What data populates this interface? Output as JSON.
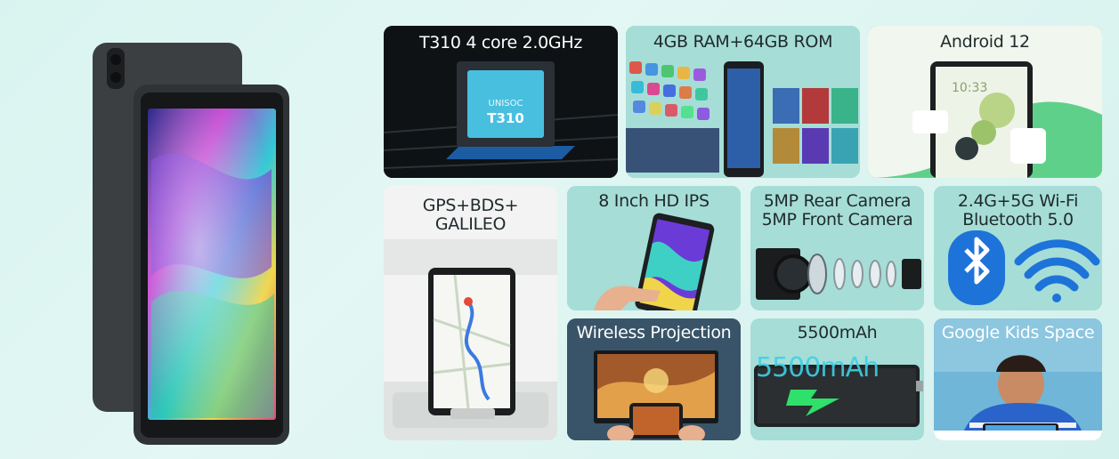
{
  "tiles": {
    "processor": {
      "label": "T310 4 core 2.0GHz",
      "chip_brand": "UNISOC",
      "chip_model": "T310"
    },
    "memory": {
      "label": "4GB RAM+64GB ROM"
    },
    "os": {
      "label": "Android 12",
      "clock": "10:33"
    },
    "gps": {
      "label_line1": "GPS+BDS+",
      "label_line2": "GALILEO"
    },
    "display": {
      "label": "8 Inch HD IPS"
    },
    "camera": {
      "label_line1": "5MP Rear Camera",
      "label_line2": "5MP Front Camera"
    },
    "wireless": {
      "label_line1": "2.4G+5G Wi-Fi",
      "label_line2": "Bluetooth 5.0"
    },
    "projection": {
      "label": "Wireless Projection"
    },
    "battery": {
      "label": "5500mAh",
      "overlay_text": "5500mAh"
    },
    "kids": {
      "label": "Google Kids Space"
    }
  },
  "colors": {
    "background": "#dcf5f1",
    "tile_teal": "#a6ddd7",
    "tile_dark": "#111416",
    "android_green": "#5ed08a",
    "bluetooth_blue": "#1e73d9",
    "battery_green": "#2fe06a"
  }
}
